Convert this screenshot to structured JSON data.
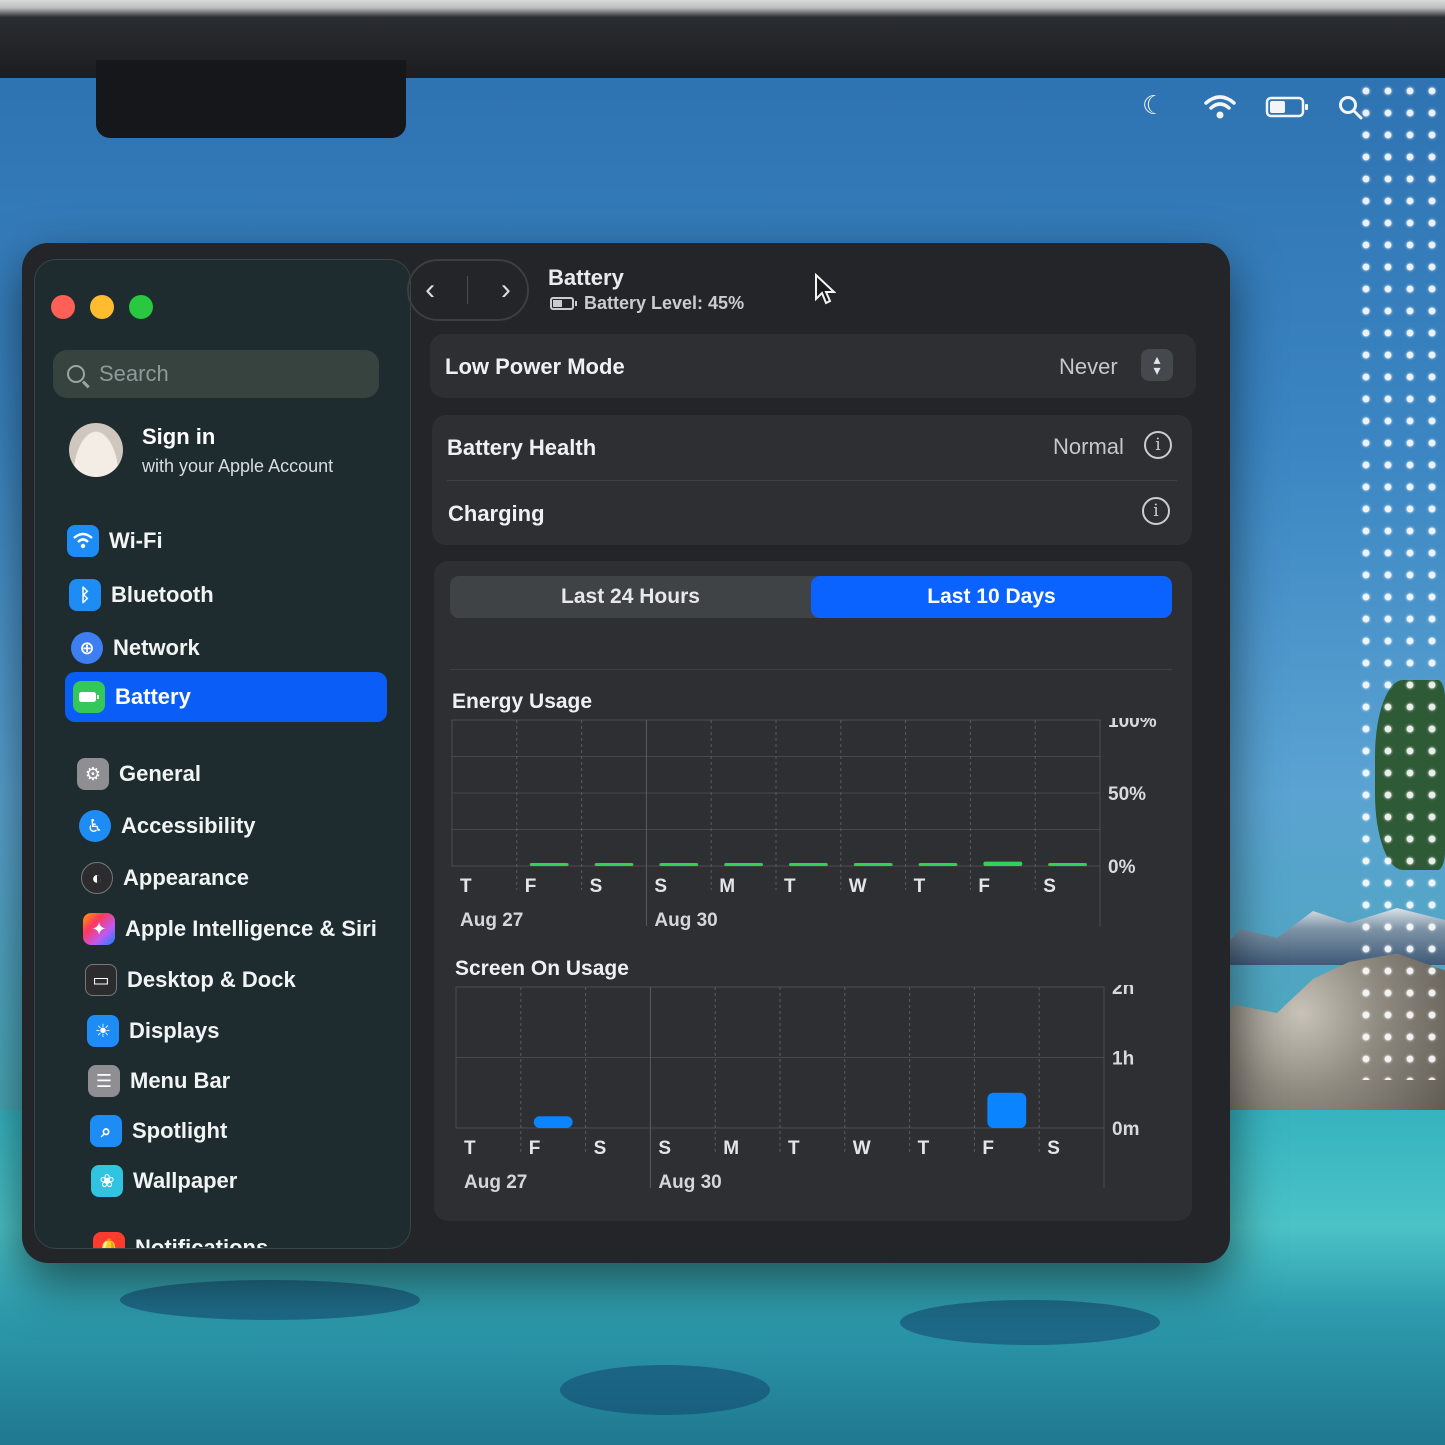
{
  "sidebar": {
    "search_placeholder": "Search",
    "account": {
      "title": "Sign in",
      "subtitle": "with your Apple Account"
    },
    "items": [
      {
        "label": "Wi-Fi",
        "icon": "wifi-icon",
        "color": "#1e90ff"
      },
      {
        "label": "Bluetooth",
        "icon": "bluetooth-icon",
        "color": "#1e90ff"
      },
      {
        "label": "Network",
        "icon": "globe-icon",
        "color": "#3b82f6"
      },
      {
        "label": "Battery",
        "icon": "battery-icon",
        "color": "#34c759",
        "active": true
      },
      {
        "label": "General",
        "icon": "gear-icon",
        "color": "#8e8e93"
      },
      {
        "label": "Accessibility",
        "icon": "accessibility-icon",
        "color": "#1e90ff"
      },
      {
        "label": "Appearance",
        "icon": "appearance-icon",
        "color": "#2c2c2e"
      },
      {
        "label": "Apple Intelligence & Siri",
        "icon": "siri-icon",
        "color": "#ff7a59"
      },
      {
        "label": "Desktop & Dock",
        "icon": "dock-icon",
        "color": "#2c2c2e"
      },
      {
        "label": "Displays",
        "icon": "sun-icon",
        "color": "#1e90ff"
      },
      {
        "label": "Menu Bar",
        "icon": "menu-bar-icon",
        "color": "#8e8e93"
      },
      {
        "label": "Spotlight",
        "icon": "magnifier-icon",
        "color": "#1e90ff"
      },
      {
        "label": "Wallpaper",
        "icon": "flower-icon",
        "color": "#30c4e0"
      },
      {
        "label": "Notifications",
        "icon": "bell-icon",
        "color": "#ff3b30"
      }
    ]
  },
  "header": {
    "title": "Battery",
    "battery_level": "Battery Level: 45%"
  },
  "settings": {
    "low_power_mode": {
      "label": "Low Power Mode",
      "value": "Never"
    },
    "battery_health": {
      "label": "Battery Health",
      "value": "Normal"
    },
    "charging": {
      "label": "Charging"
    }
  },
  "tabs": {
    "last_24": "Last 24 Hours",
    "last_10": "Last 10 Days",
    "selected": "Last 10 Days"
  },
  "colors": {
    "accent": "#0a63ff",
    "energy_bar": "#30d158",
    "screen_bar": "#0a84ff"
  },
  "chart_data": [
    {
      "type": "bar",
      "title": "Energy Usage",
      "categories": [
        "T",
        "F",
        "S",
        "S",
        "M",
        "T",
        "W",
        "T",
        "F",
        "S"
      ],
      "date_labels": [
        "Aug 27",
        "Aug 30"
      ],
      "yticks": [
        "100%",
        "50%",
        "0%"
      ],
      "ylim": [
        0,
        100
      ],
      "values": [
        0,
        2,
        2,
        2,
        2,
        2,
        2,
        2,
        3,
        1
      ]
    },
    {
      "type": "bar",
      "title": "Screen On Usage",
      "categories": [
        "T",
        "F",
        "S",
        "S",
        "M",
        "T",
        "W",
        "T",
        "F",
        "S"
      ],
      "date_labels": [
        "Aug 27",
        "Aug 30"
      ],
      "yticks": [
        "2h",
        "1h",
        "0m"
      ],
      "ylim": [
        0,
        120
      ],
      "values": [
        0,
        10,
        0,
        0,
        0,
        0,
        0,
        0,
        30,
        0
      ]
    }
  ]
}
